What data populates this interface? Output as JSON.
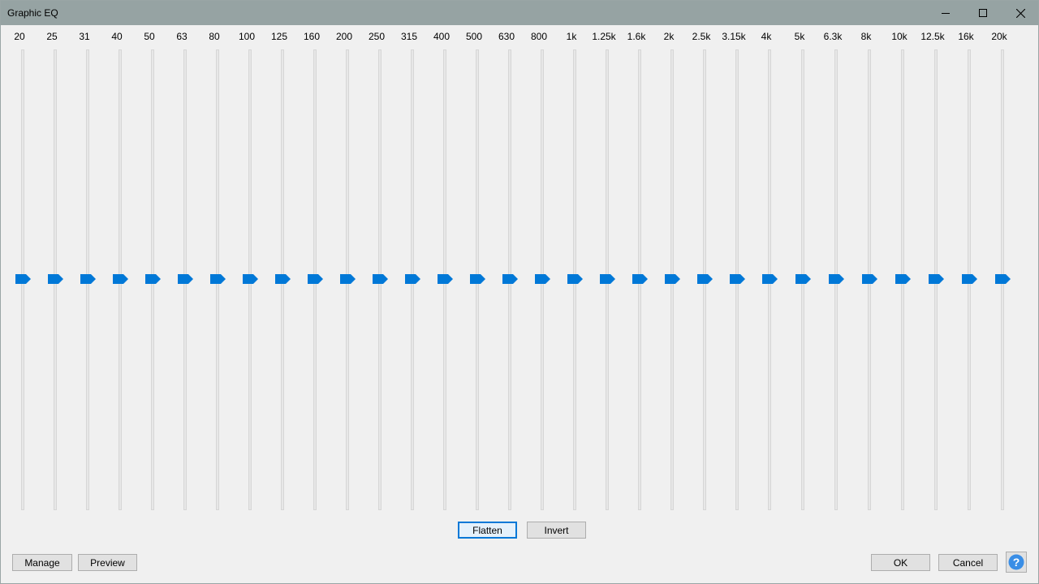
{
  "window": {
    "title": "Graphic EQ"
  },
  "titlebar_icons": {
    "minimize": "minimize-icon",
    "maximize": "maximize-icon",
    "close": "close-icon"
  },
  "bands": [
    {
      "label": "20",
      "gain_db": 0
    },
    {
      "label": "25",
      "gain_db": 0
    },
    {
      "label": "31",
      "gain_db": 0
    },
    {
      "label": "40",
      "gain_db": 0
    },
    {
      "label": "50",
      "gain_db": 0
    },
    {
      "label": "63",
      "gain_db": 0
    },
    {
      "label": "80",
      "gain_db": 0
    },
    {
      "label": "100",
      "gain_db": 0
    },
    {
      "label": "125",
      "gain_db": 0
    },
    {
      "label": "160",
      "gain_db": 0
    },
    {
      "label": "200",
      "gain_db": 0
    },
    {
      "label": "250",
      "gain_db": 0
    },
    {
      "label": "315",
      "gain_db": 0
    },
    {
      "label": "400",
      "gain_db": 0
    },
    {
      "label": "500",
      "gain_db": 0
    },
    {
      "label": "630",
      "gain_db": 0
    },
    {
      "label": "800",
      "gain_db": 0
    },
    {
      "label": "1k",
      "gain_db": 0
    },
    {
      "label": "1.25k",
      "gain_db": 0
    },
    {
      "label": "1.6k",
      "gain_db": 0
    },
    {
      "label": "2k",
      "gain_db": 0
    },
    {
      "label": "2.5k",
      "gain_db": 0
    },
    {
      "label": "3.15k",
      "gain_db": 0
    },
    {
      "label": "4k",
      "gain_db": 0
    },
    {
      "label": "5k",
      "gain_db": 0
    },
    {
      "label": "6.3k",
      "gain_db": 0
    },
    {
      "label": "8k",
      "gain_db": 0
    },
    {
      "label": "10k",
      "gain_db": 0
    },
    {
      "label": "12.5k",
      "gain_db": 0
    },
    {
      "label": "16k",
      "gain_db": 0
    },
    {
      "label": "20k",
      "gain_db": 0
    }
  ],
  "buttons": {
    "flatten": "Flatten",
    "invert": "Invert",
    "manage": "Manage",
    "preview": "Preview",
    "ok": "OK",
    "cancel": "Cancel"
  },
  "colors": {
    "accent": "#0078d7",
    "titlebar": "#96a3a3",
    "help_icon": "#3a8ee6"
  },
  "help_icon": "help-icon"
}
